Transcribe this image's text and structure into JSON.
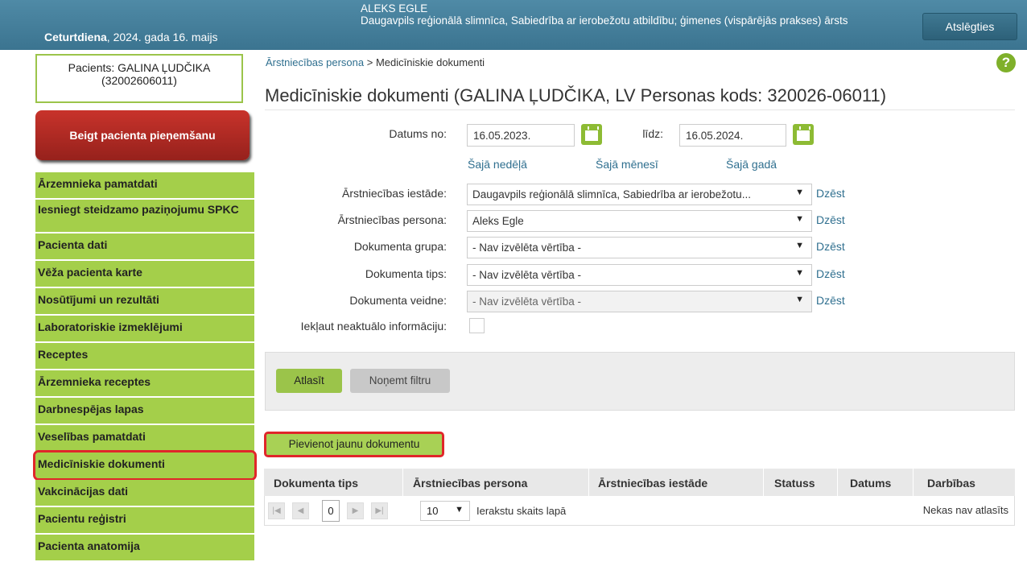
{
  "header": {
    "date_bold": "Ceturtdiena",
    "date_rest": ", 2024. gada 16. maijs",
    "user_name": "ALEKS EGLE",
    "user_org": "Daugavpils reģionālā slimnīca, Sabiedrība ar ierobežotu atbildību; ģimenes (vispārējās prakses) ārsts",
    "logout_label": "Atslēgties"
  },
  "patient": {
    "line1": "Pacients: GALINA ĻUDČIKA",
    "line2": "(32002606011)",
    "end_visit_label": "Beigt pacienta pieņemšanu"
  },
  "sidebar": {
    "items": [
      {
        "label": "Ārzemnieka pamatdati"
      },
      {
        "label": "Iesniegt steidzamo paziņojumu SPKC"
      },
      {
        "label": "Pacienta dati"
      },
      {
        "label": "Vēža pacienta karte"
      },
      {
        "label": "Nosūtījumi un rezultāti"
      },
      {
        "label": "Laboratoriskie izmeklējumi"
      },
      {
        "label": "Receptes"
      },
      {
        "label": "Ārzemnieka receptes"
      },
      {
        "label": "Darbnespējas lapas"
      },
      {
        "label": "Veselības pamatdati"
      },
      {
        "label": "Medicīniskie dokumenti"
      },
      {
        "label": "Vakcinācijas dati"
      },
      {
        "label": "Pacientu reģistri"
      },
      {
        "label": "Pacienta anatomija"
      }
    ]
  },
  "breadcrumb": {
    "root": "Ārstniecības persona",
    "separator": " > ",
    "current": "Medicīniskie dokumenti"
  },
  "page": {
    "title": "Medicīniskie dokumenti (GALINA ĻUDČIKA, LV Personas kods: 320026-06011)",
    "help": "?"
  },
  "filters": {
    "date_from_label": "Datums no:",
    "date_from_value": "16.05.2023.",
    "date_to_label": "līdz:",
    "date_to_value": "16.05.2024.",
    "quick_week": "Šajā nedēļā",
    "quick_month": "Šajā mēnesī",
    "quick_year": "Šajā gadā",
    "institution_label": "Ārstniecības iestāde:",
    "institution_value": "Daugavpils reģionālā slimnīca, Sabiedrība ar ierobežotu...",
    "person_label": "Ārstniecības persona:",
    "person_value": "Aleks Egle",
    "group_label": "Dokumenta grupa:",
    "group_value": "- Nav izvēlēta vērtība -",
    "type_label": "Dokumenta tips:",
    "type_value": "- Nav izvēlēta vērtība -",
    "template_label": "Dokumenta veidne:",
    "template_value": "- Nav izvēlēta vērtība -",
    "include_label": "Iekļaut neaktuālo informāciju:",
    "delete_label": "Dzēst",
    "arrow": "▼"
  },
  "actions": {
    "select_label": "Atlasīt",
    "clear_label": "Noņemt filtru",
    "add_label": "Pievienot jaunu dokumentu"
  },
  "table": {
    "columns": [
      "Dokumenta tips",
      "Ārstniecības persona",
      "Ārstniecības iestāde",
      "Statuss",
      "Datums",
      "Darbības"
    ],
    "page_number": "0",
    "page_size": "10",
    "page_size_text": "Ierakstu skaits lapā",
    "empty_text": "Nekas nav atlasīts"
  }
}
